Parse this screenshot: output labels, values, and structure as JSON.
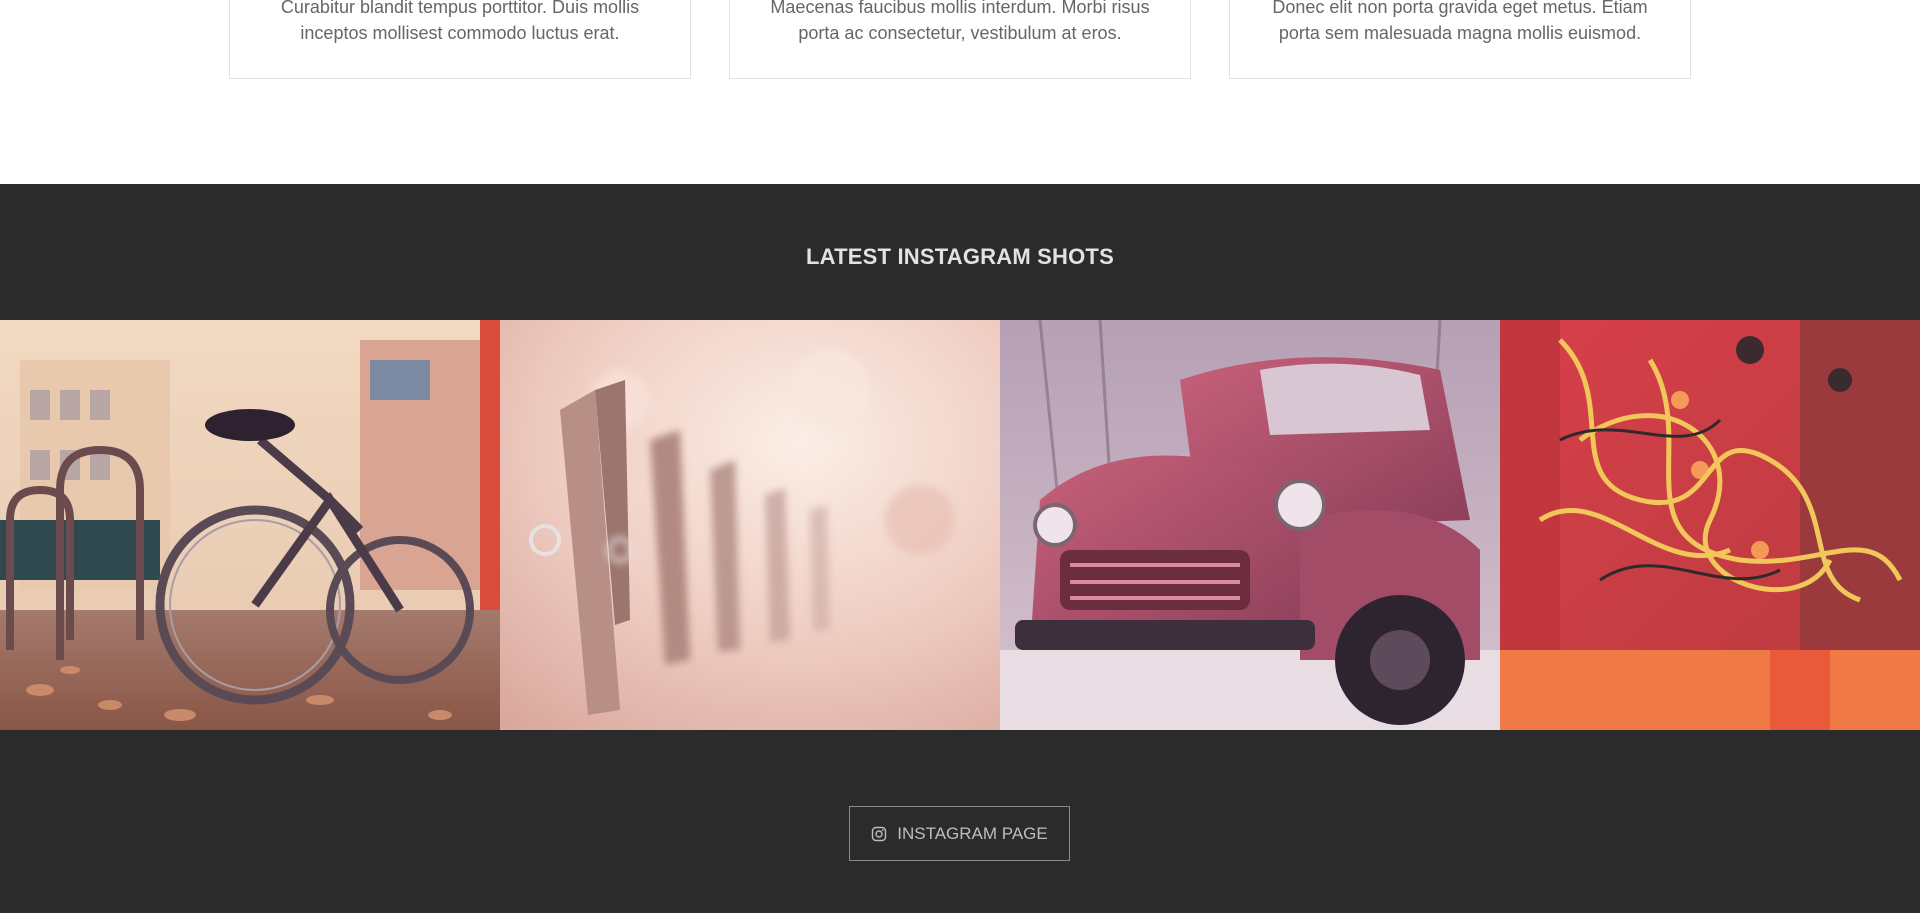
{
  "cards": [
    {
      "text": "Curabitur blandit tempus porttitor. Duis mollis inceptos mollisest commodo luctus erat."
    },
    {
      "text": "Maecenas faucibus mollis interdum. Morbi risus porta ac consectetur, vestibulum at eros."
    },
    {
      "text": "Donec elit non porta gravida eget metus. Etiam porta sem malesuada magna mollis euismod."
    }
  ],
  "instagram": {
    "title": "LATEST INSTAGRAM SHOTS",
    "shots": [
      {
        "subject": "bicycle-on-leaves"
      },
      {
        "subject": "clothespins"
      },
      {
        "subject": "rusty-truck"
      },
      {
        "subject": "tangled-wires"
      }
    ],
    "button_label": "INSTAGRAM PAGE",
    "button_icon": "instagram-icon"
  },
  "colors": {
    "dark_bg": "#2b2b2b",
    "card_border": "#e3e3e3",
    "body_text": "#666666",
    "title_text": "#e2e2e2",
    "button_border": "#8a8a8a"
  }
}
